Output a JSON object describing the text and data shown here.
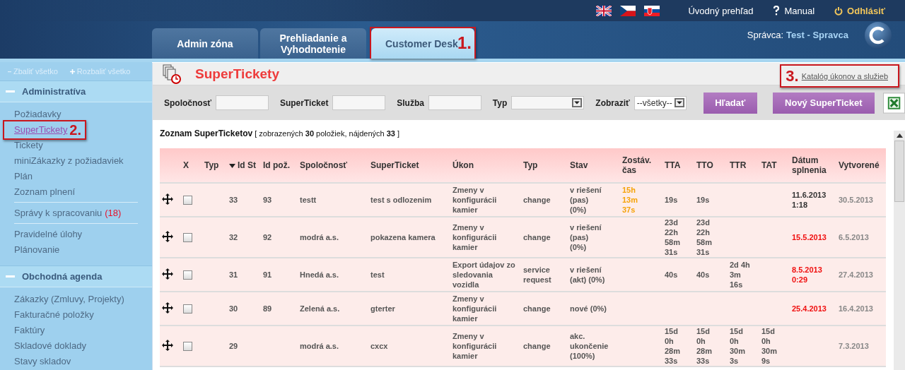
{
  "topbar": {
    "flags": [
      {
        "kind": "uk"
      },
      {
        "kind": "cz"
      },
      {
        "kind": "sk"
      }
    ],
    "links": [
      {
        "kind": "home",
        "label": "Úvodný prehľad"
      },
      {
        "kind": "help",
        "label": "Manual"
      },
      {
        "kind": "logout",
        "label": "Odhlásiť"
      }
    ]
  },
  "tabs": [
    {
      "label": "Admin zóna",
      "selected": false
    },
    {
      "label": "Prehliadanie a Vyhodnotenie",
      "selected": false
    },
    {
      "label": "Customer Desk",
      "selected": true,
      "annotation": "1."
    }
  ],
  "user": {
    "role": "Správca:",
    "name": "Test - Spravca"
  },
  "sidebar": {
    "collapse": "Zbaliť všetko",
    "expand": "Rozbaliť všetko",
    "sections": [
      {
        "title": "Administratíva",
        "expanded": true,
        "groups": [
          {
            "items": [
              {
                "label": "Požiadavky",
                "selected": false
              },
              {
                "label": "SuperTickety",
                "selected": true,
                "annotation": "2."
              },
              {
                "label": "Tickety",
                "selected": false
              },
              {
                "label": "miniZákazky z požiadaviek",
                "selected": false
              },
              {
                "label": "Plán",
                "selected": false
              },
              {
                "label": "Zoznam plnení",
                "selected": false
              }
            ]
          },
          {
            "items": [
              {
                "label": "Správy k spracovaniu",
                "count": "(18)",
                "selected": false
              }
            ]
          },
          {
            "items": [
              {
                "label": "Pravidelné úlohy",
                "selected": false
              },
              {
                "label": "Plánovanie",
                "selected": false
              }
            ]
          }
        ]
      },
      {
        "title": "Obchodná agenda",
        "expanded": true,
        "groups": [
          {
            "items": [
              {
                "label": "Zákazky (Zmluvy, Projekty)",
                "selected": false
              },
              {
                "label": "Fakturačné položky",
                "selected": false
              },
              {
                "label": "Faktúry",
                "selected": false
              },
              {
                "label": "Skladové doklady",
                "selected": false
              },
              {
                "label": "Stavy skladov",
                "selected": false
              }
            ]
          }
        ]
      }
    ]
  },
  "page": {
    "title": "SuperTickety",
    "catalog_link": "Katalóg úkonov a služieb",
    "catalog_annotation": "3."
  },
  "filters": [
    {
      "kind": "text",
      "label": "Spoločnosť"
    },
    {
      "kind": "text",
      "label": "SuperTicket"
    },
    {
      "kind": "text",
      "label": "Služba"
    },
    {
      "kind": "select",
      "label": "Typ"
    },
    {
      "kind": "select",
      "label": "Zobraziť",
      "value": "--všetky--"
    }
  ],
  "buttons": [
    "Hľadať",
    "Nový SuperTicket"
  ],
  "list": {
    "title": "Zoznam SuperTicketov",
    "summary": "[ zobrazených **30** položiek, nájdených **33** ]"
  },
  "table": {
    "columns": [
      {
        "label": "X",
        "sorted": false
      },
      {
        "label": "Typ",
        "sorted": false
      },
      {
        "label": "Id St",
        "sorted": true
      },
      {
        "label": "Id pož.",
        "sorted": false
      },
      {
        "label": "Spoločnosť",
        "sorted": false
      },
      {
        "label": "SuperTicket",
        "sorted": false
      },
      {
        "label": "Úkon",
        "sorted": false
      },
      {
        "label": "Typ",
        "sorted": false
      },
      {
        "label": "Stav",
        "sorted": false
      },
      {
        "label": "Zostáv. čas",
        "sorted": false
      },
      {
        "label": "TTA",
        "sorted": false
      },
      {
        "label": "TTO",
        "sorted": false
      },
      {
        "label": "TTR",
        "sorted": false
      },
      {
        "label": "TAT",
        "sorted": false
      },
      {
        "label": "Dátum splnenia",
        "sorted": false
      },
      {
        "label": "Vytvorené",
        "sorted": false
      }
    ],
    "rows": [
      {
        "checked": false,
        "id_st": "33",
        "id_poz": "93",
        "company": "testt",
        "superticket": "test s odlozenim",
        "task": "Zmeny v konfigurácii kamier",
        "type": "change",
        "state": "v riešení (pas) (0%)",
        "remaining": "15h 13m 37s",
        "tta": "19s",
        "tto": "19s",
        "due": "11.6.2013 1:18",
        "overdue": false,
        "created": "30.5.2013"
      },
      {
        "checked": false,
        "id_st": "32",
        "id_poz": "92",
        "company": "modrá a.s.",
        "superticket": "pokazena kamera",
        "task": "Zmeny v konfigurácii kamier",
        "type": "change",
        "state": "v riešení (pas) (0%)",
        "tta": "23d 22h 58m 31s",
        "tto": "23d 22h 58m 31s",
        "due": "15.5.2013",
        "overdue": true,
        "created": "6.5.2013"
      },
      {
        "checked": false,
        "id_st": "31",
        "id_poz": "91",
        "company": "Hnedá a.s.",
        "superticket": "test",
        "task": "Export údajov zo sledovania vozidla",
        "type": "service request",
        "state": "v riešení (akt) (0%)",
        "tta": "40s",
        "tto": "40s",
        "ttr": "2d 4h 3m 16s",
        "due": "8.5.2013 0:29",
        "overdue": true,
        "created": "27.4.2013"
      },
      {
        "checked": false,
        "id_st": "30",
        "id_poz": "89",
        "company": "Zelená a.s.",
        "superticket": "gterter",
        "task": "Zmeny v konfigurácii kamier",
        "type": "change",
        "state": "nové (0%)",
        "due": "25.4.2013",
        "overdue": true,
        "created": "16.4.2013"
      },
      {
        "checked": false,
        "id_st": "29",
        "company": "modrá a.s.",
        "superticket": "cxcx",
        "task": "Zmeny v konfigurácii kamier",
        "type": "change",
        "state": "akc. ukončenie (100%)",
        "tta": "15d 0h 28m 33s",
        "tto": "15d 0h 28m 33s",
        "ttr": "15d 0h 30m 3s",
        "tat": "15d 0h 30m 9s",
        "created": "7.3.2013"
      }
    ]
  }
}
